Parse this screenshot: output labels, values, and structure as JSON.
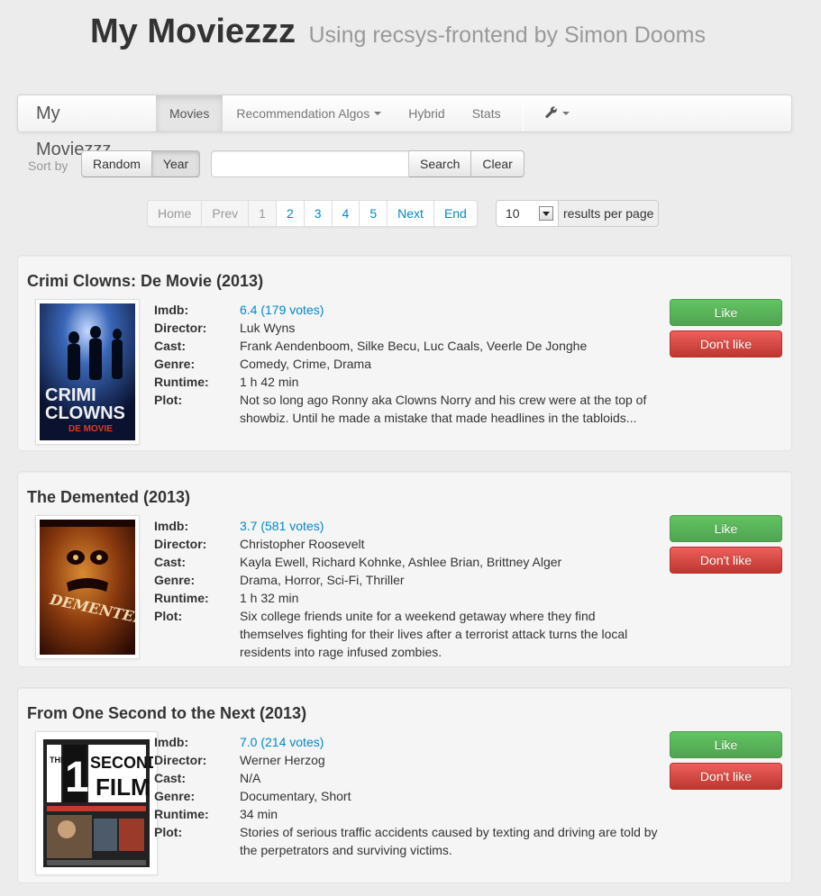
{
  "header": {
    "title": "My Moviezzz",
    "subtitle": "Using recsys-frontend by Simon Dooms"
  },
  "navbar": {
    "brand": "My Moviezzz",
    "items": [
      {
        "label": "Movies",
        "active": true
      },
      {
        "label": "Recommendation Algos",
        "dropdown": true
      },
      {
        "label": "Hybrid"
      },
      {
        "label": "Stats"
      }
    ],
    "tools_icon": "wrench-icon"
  },
  "sort": {
    "label": "Sort by",
    "options": [
      "Random",
      "Year"
    ],
    "selected": "Year"
  },
  "search": {
    "value": "",
    "placeholder": "",
    "search_label": "Search",
    "clear_label": "Clear"
  },
  "pagination": {
    "home": "Home",
    "prev": "Prev",
    "pages": [
      "1",
      "2",
      "3",
      "4",
      "5"
    ],
    "next": "Next",
    "end": "End",
    "current_page": "1",
    "per_page_value": "10",
    "per_page_label": "results per page"
  },
  "labels": {
    "imdb": "Imdb:",
    "director": "Director:",
    "cast": "Cast:",
    "genre": "Genre:",
    "runtime": "Runtime:",
    "plot": "Plot:",
    "like": "Like",
    "dislike": "Don't like"
  },
  "movies": [
    {
      "title": "Crimi Clowns: De Movie (2013)",
      "imdb": "6.4 (179 votes)",
      "director": "Luk Wyns",
      "cast": "Frank Aendenboom, Silke Becu, Luc Caals, Veerle De Jonghe",
      "genre": "Comedy, Crime, Drama",
      "runtime": "1 h 42 min",
      "plot": "Not so long ago Ronny aka Clowns Norry and his crew were at the top of showbiz. Until he made a mistake that made headlines in the tabloids...",
      "poster_text": [
        "CRIMI",
        "CLOWNS",
        "DE MOVIE"
      ]
    },
    {
      "title": "The Demented (2013)",
      "imdb": "3.7 (581 votes)",
      "director": "Christopher Roosevelt",
      "cast": "Kayla Ewell, Richard Kohnke, Ashlee Brian, Brittney Alger",
      "genre": "Drama, Horror, Sci-Fi, Thriller",
      "runtime": "1 h 32 min",
      "plot": "Six college friends unite for a weekend getaway where they find themselves fighting for their lives after a terrorist attack turns the local residents into rage infused zombies.",
      "poster_text": [
        "DEMENTED"
      ]
    },
    {
      "title": "From One Second to the Next (2013)",
      "imdb": "7.0 (214 votes)",
      "director": "Werner Herzog",
      "cast": "N/A",
      "genre": "Documentary, Short",
      "runtime": "34 min",
      "plot": "Stories of serious traffic accidents caused by texting and driving are told by the perpetrators and surviving victims.",
      "poster_text": [
        "THE",
        "1",
        "SECOND",
        "FILM"
      ]
    }
  ],
  "colors": {
    "link": "#0088cc",
    "like": "#5bb75b",
    "dislike": "#da4f49",
    "background": "#ececec"
  }
}
